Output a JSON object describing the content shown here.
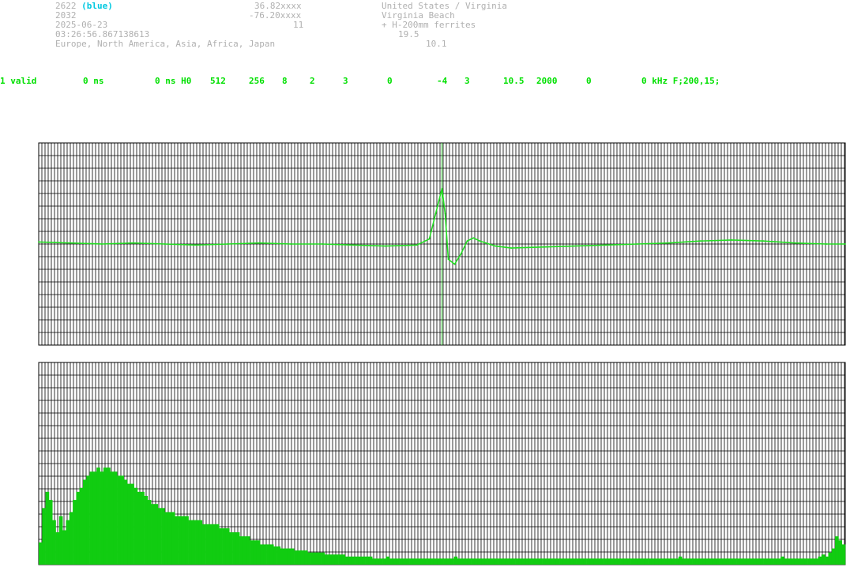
{
  "header": {
    "station_id": "2622",
    "station_color": "(blue)",
    "secondary_id": "2032",
    "date": "2025-06-23",
    "time": "03:26:56.867138613",
    "regions": "Europe, North America, Asia, Africa, Japan",
    "latitude": "36.82xxxx",
    "longitude": "-76.20xxxx",
    "value_11": "11",
    "country": "United States / Virginia",
    "city": "Virginia Beach",
    "antenna": "+ H-200mm ferrites",
    "value_19_5": "19.5",
    "value_10_1": "10.1"
  },
  "status": {
    "f1": "1 valid",
    "f2": "0 ns",
    "f3": "0 ns H0",
    "f4": "512",
    "f5": "256",
    "f6": "8",
    "f7": "2",
    "f8": "3",
    "f9": "0",
    "f10": "-4",
    "f11": "3",
    "f12": "10.5",
    "f13": "2000",
    "f14": "0",
    "f15": "0 kHz F;200,15;"
  },
  "colors": {
    "trace": "#22dd22",
    "grid": "#000000",
    "marker": "#33cc33",
    "spectrum": "#11cc11",
    "header_text": "#b0b0b0",
    "status_text": "#00e000",
    "station_color": "#00c8e0"
  },
  "chart_data": [
    {
      "type": "line",
      "title": "",
      "xlabel": "",
      "ylabel": "",
      "grid": true,
      "x_range": [
        0,
        512
      ],
      "y_range": [
        -1,
        1
      ],
      "marker_x": 256,
      "series": [
        {
          "x": [
            0,
            20,
            40,
            60,
            80,
            100,
            120,
            140,
            160,
            180,
            200,
            220,
            240,
            248,
            252,
            256,
            258,
            260,
            264,
            268,
            272,
            276,
            280,
            290,
            300,
            320,
            340,
            360,
            380,
            400,
            420,
            440,
            460,
            480,
            500,
            512
          ],
          "values": [
            0.02,
            0.01,
            0.0,
            0.01,
            0.0,
            -0.01,
            0.0,
            0.01,
            0.0,
            0.0,
            -0.01,
            -0.02,
            -0.01,
            0.05,
            0.3,
            0.55,
            0.3,
            -0.15,
            -0.2,
            -0.1,
            0.03,
            0.06,
            0.03,
            -0.02,
            -0.04,
            -0.03,
            -0.02,
            -0.01,
            0.0,
            0.01,
            0.03,
            0.04,
            0.03,
            0.01,
            0.0,
            0.0
          ]
        }
      ]
    },
    {
      "type": "bar",
      "title": "",
      "xlabel": "",
      "ylabel": "",
      "grid": true,
      "y_range": [
        0,
        1
      ],
      "values": [
        0.11,
        0.28,
        0.36,
        0.32,
        0.22,
        0.16,
        0.24,
        0.17,
        0.22,
        0.26,
        0.32,
        0.36,
        0.38,
        0.42,
        0.44,
        0.46,
        0.46,
        0.48,
        0.46,
        0.48,
        0.48,
        0.46,
        0.46,
        0.44,
        0.44,
        0.42,
        0.4,
        0.4,
        0.38,
        0.36,
        0.36,
        0.34,
        0.32,
        0.3,
        0.3,
        0.28,
        0.28,
        0.26,
        0.26,
        0.26,
        0.24,
        0.24,
        0.24,
        0.24,
        0.22,
        0.22,
        0.22,
        0.22,
        0.2,
        0.2,
        0.2,
        0.2,
        0.2,
        0.18,
        0.18,
        0.18,
        0.16,
        0.16,
        0.16,
        0.14,
        0.14,
        0.14,
        0.12,
        0.12,
        0.12,
        0.1,
        0.1,
        0.1,
        0.1,
        0.09,
        0.09,
        0.08,
        0.08,
        0.08,
        0.08,
        0.07,
        0.07,
        0.07,
        0.07,
        0.06,
        0.06,
        0.06,
        0.06,
        0.06,
        0.05,
        0.05,
        0.05,
        0.05,
        0.05,
        0.05,
        0.04,
        0.04,
        0.04,
        0.04,
        0.04,
        0.04,
        0.04,
        0.04,
        0.03,
        0.03,
        0.03,
        0.03,
        0.04,
        0.03,
        0.03,
        0.03,
        0.03,
        0.03,
        0.03,
        0.03,
        0.03,
        0.03,
        0.03,
        0.03,
        0.03,
        0.03,
        0.03,
        0.03,
        0.03,
        0.03,
        0.03,
        0.03,
        0.04,
        0.03,
        0.03,
        0.03,
        0.03,
        0.03,
        0.03,
        0.03,
        0.03,
        0.03,
        0.03,
        0.03,
        0.03,
        0.03,
        0.03,
        0.03,
        0.03,
        0.03,
        0.03,
        0.03,
        0.03,
        0.03,
        0.03,
        0.03,
        0.03,
        0.03,
        0.03,
        0.03,
        0.03,
        0.03,
        0.03,
        0.03,
        0.03,
        0.03,
        0.03,
        0.03,
        0.03,
        0.03,
        0.03,
        0.03,
        0.03,
        0.03,
        0.03,
        0.03,
        0.03,
        0.03,
        0.03,
        0.03,
        0.03,
        0.03,
        0.03,
        0.03,
        0.03,
        0.03,
        0.03,
        0.03,
        0.03,
        0.03,
        0.03,
        0.03,
        0.03,
        0.03,
        0.03,
        0.03,
        0.03,
        0.03,
        0.04,
        0.03,
        0.03,
        0.03,
        0.03,
        0.03,
        0.03,
        0.03,
        0.03,
        0.03,
        0.03,
        0.03,
        0.03,
        0.03,
        0.03,
        0.03,
        0.03,
        0.03,
        0.03,
        0.03,
        0.03,
        0.03,
        0.03,
        0.03,
        0.03,
        0.03,
        0.03,
        0.03,
        0.03,
        0.03,
        0.04,
        0.03,
        0.03,
        0.03,
        0.03,
        0.03,
        0.03,
        0.03,
        0.03,
        0.03,
        0.03,
        0.04,
        0.05,
        0.04,
        0.06,
        0.08,
        0.14,
        0.12,
        0.1
      ]
    }
  ]
}
